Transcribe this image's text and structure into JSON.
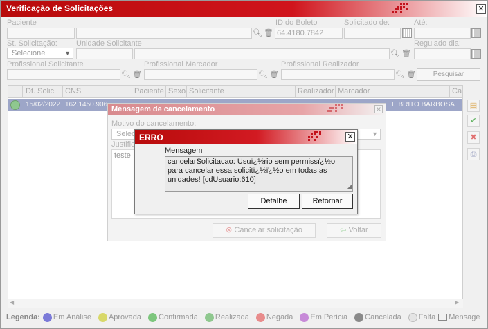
{
  "window": {
    "title": "Verificação de Solicitações"
  },
  "filters": {
    "paciente_label": "Paciente",
    "id_boleto_label": "ID do Boleto",
    "id_boleto_value": "64.4180.7842",
    "solicitado_de_label": "Solicitado de:",
    "ate_label": "Até:",
    "st_solicitacao_label": "St. Solicitação:",
    "st_solicitacao_value": "Selecione",
    "unidade_solicitante_label": "Unidade Solicitante",
    "regulado_dia_label": "Regulado dia:",
    "prof_solicitante_label": "Profissional Solicitante",
    "prof_marcador_label": "Profissional Marcador",
    "prof_realizador_label": "Profissional Realizador",
    "pesquisar_label": "Pesquisar"
  },
  "grid": {
    "columns": [
      "Dt. Solic.",
      "CNS",
      "Paciente",
      "Sexo",
      "Solicitante",
      "Realizador",
      "Marcador",
      "Ca"
    ],
    "rows": [
      {
        "dt_solic": "15/02/2022",
        "cns": "162.1450.906",
        "marcador": "E BRITO BARBOSA"
      }
    ]
  },
  "legend": {
    "title": "Legenda:",
    "items": [
      {
        "label": "Em Análise",
        "color": "#7b7ad8"
      },
      {
        "label": "Aprovada",
        "color": "#d8d86a"
      },
      {
        "label": "Confirmada",
        "color": "#7dc67d"
      },
      {
        "label": "Realizada",
        "color": "#8fc88f"
      },
      {
        "label": "Negada",
        "color": "#e88c8c"
      },
      {
        "label": "Em Perícia",
        "color": "#c78ad8"
      },
      {
        "label": "Cancelada",
        "color": "#8a8a8a"
      },
      {
        "label": "Falta",
        "color": "#d8d8d8"
      },
      {
        "label": "Mensage",
        "color": "#ffffff"
      }
    ]
  },
  "cancel_dialog": {
    "title": "Mensagem de cancelamento",
    "motivo_label": "Motivo do cancelamento:",
    "motivo_value": "Selecio",
    "justificativa_label": "Justific",
    "justificativa_value": "teste",
    "cancelar_label": "Cancelar solicitação",
    "voltar_label": "Voltar"
  },
  "error_dialog": {
    "title": "ERRO",
    "message_label": "Mensagem",
    "message": "cancelarSolicitacao: Usuï¿½rio sem permissï¿½o para cancelar essa solicitï¿½ï¿½o em todas as unidades! [cdUsuario:610]",
    "detalhe_label": "Detalhe",
    "retornar_label": "Retornar"
  }
}
